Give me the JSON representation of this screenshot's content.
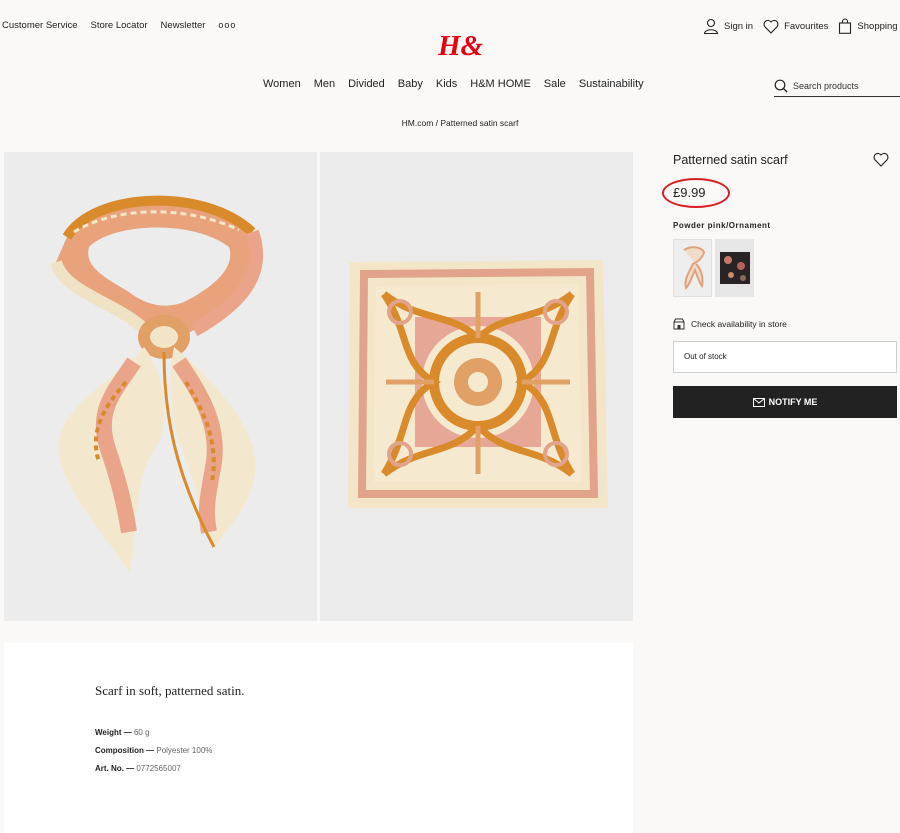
{
  "header": {
    "top_links": [
      "Customer Service",
      "Store Locator",
      "Newsletter",
      "ooo"
    ],
    "logo_text": "H&M",
    "sign_in": "Sign in",
    "favourites": "Favourites",
    "shopping_bag": "Shopping bag",
    "brand_color": "#e50010"
  },
  "nav": {
    "items": [
      "Women",
      "Men",
      "Divided",
      "Baby",
      "Kids",
      "H&M HOME",
      "Sale",
      "Sustainability"
    ],
    "search_placeholder": "Search products"
  },
  "breadcrumb": "HM.com / Patterned satin scarf",
  "product": {
    "title": "Patterned satin scarf",
    "price": "£9.99",
    "color_name": "Powder pink/Ornament",
    "check_availability": "Check availability in store",
    "stock_status": "Out of stock",
    "notify_label": "NOTIFY ME",
    "highlight_color": "#d91c20"
  },
  "description": {
    "text": "Scarf in soft, patterned satin.",
    "specs": [
      {
        "label": "Weight",
        "value": "60 g"
      },
      {
        "label": "Composition",
        "value": "Polyester 100%"
      },
      {
        "label": "Art. No.",
        "value": "0772565007"
      }
    ]
  }
}
